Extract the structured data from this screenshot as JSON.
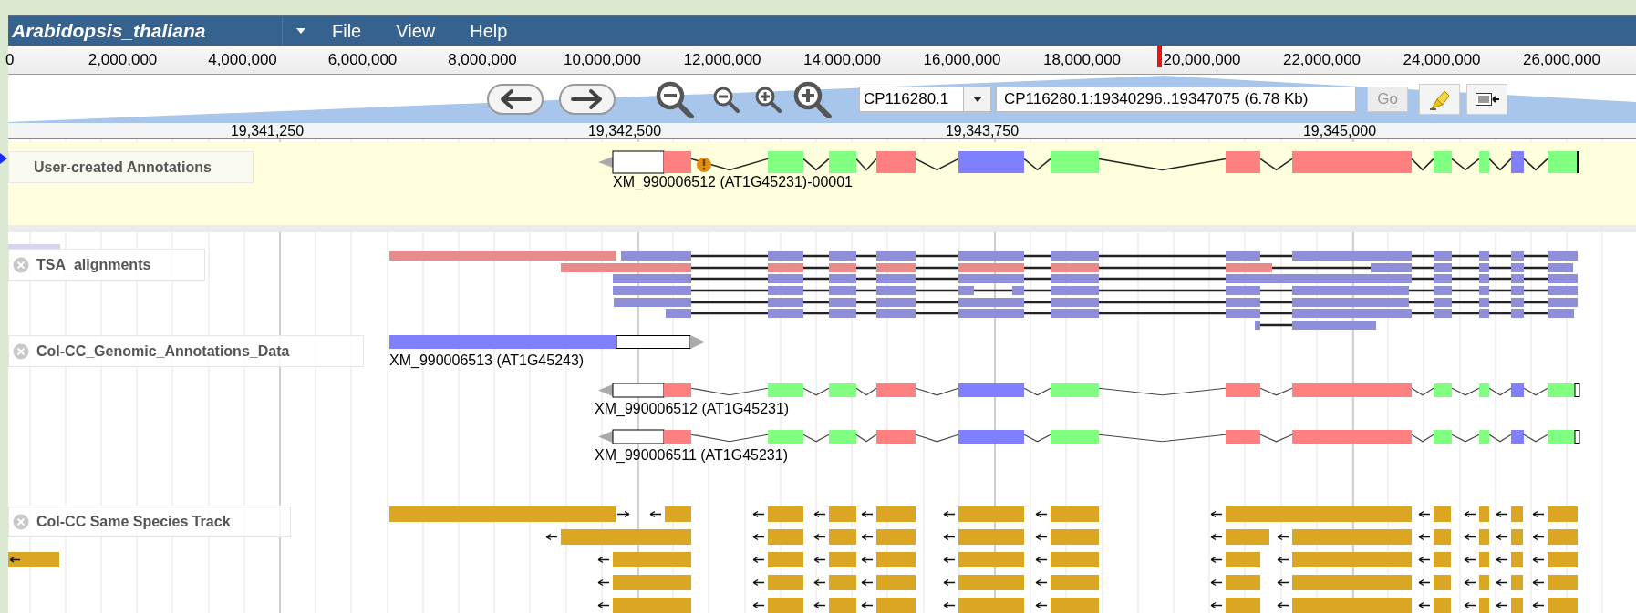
{
  "menubar": {
    "genome": "Arabidopsis_thaliana",
    "menus": [
      "File",
      "View",
      "Help"
    ]
  },
  "overview": {
    "ticks": [
      "0",
      "2,000,000",
      "4,000,000",
      "6,000,000",
      "8,000,000",
      "10,000,000",
      "12,000,000",
      "14,000,000",
      "16,000,000",
      "18,000,000",
      "20,000,000",
      "22,000,000",
      "24,000,000",
      "26,000,000"
    ]
  },
  "navigation": {
    "sequence": "CP116280.1",
    "location": "CP116280.1:19340296..19347075 (6.78 Kb)",
    "go_button": {
      "label": "Go",
      "disabled": true
    }
  },
  "detail_ruler": {
    "ticks": [
      "19,341,250",
      "19,342,500",
      "19,343,750",
      "19,345,000"
    ]
  },
  "tracks": [
    {
      "kind": "annotations",
      "label": "User-created Annotations",
      "closable": false,
      "features": [
        {
          "label": "XM_990006512 (AT1G45231)-00001",
          "warning": true
        }
      ]
    },
    {
      "kind": "alignments",
      "label": "TSA_alignments",
      "closable": true
    },
    {
      "kind": "genes",
      "label": "Col-CC_Genomic_Annotations_Data",
      "closable": true,
      "features": [
        {
          "label": "XM_990006513 (AT1G45243)"
        },
        {
          "label": "XM_990006512 (AT1G45231)"
        },
        {
          "label": "XM_990006511 (AT1G45231)"
        }
      ]
    },
    {
      "kind": "species",
      "label": "Col-CC Same Species Track",
      "closable": true
    }
  ]
}
